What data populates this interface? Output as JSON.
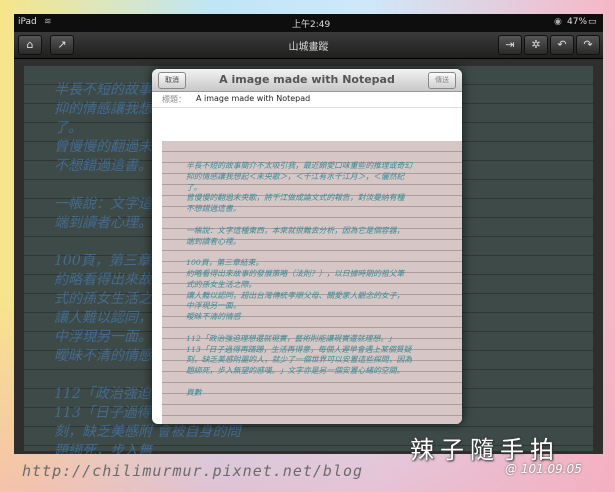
{
  "statusbar": {
    "device": "iPad",
    "time": "上午2:49",
    "battery": "47%"
  },
  "toolbar": {
    "title": "山城畫蹤",
    "home_icon": "home-icon",
    "share_icon": "share-icon",
    "import_icon": "import-icon",
    "settings_icon": "gear-icon",
    "undo_icon": "undo-icon",
    "redo_icon": "redo-icon"
  },
  "background_text": [
    "半長不短的故事：                              的那句「那樣壓",
    "抑的情感讓我想起                              總會讓我放不下",
    "了。",
    "曾慢慢的翻過未                              仍喜愛，所以我",
    "不想錯過這書。",
    "",
    "一帳說：文字這                              腦中盛載內容",
    "端到讀者心理。",
    "",
    "100頁，第三章結",
    "約略看得出來故                              ，穿插在現在",
    "式的孫女生活之",
    "讓人難以認同，                              從藝術的敘說",
    "中浮現另一面。",
    "曖昧不清的情感",
    "",
    "112「政治強迫現",
    "113「日子過得再                              值何在的時",
    "刻，缺乏美感附                              會被自身的問",
    "題綁死，步入無"
  ],
  "dialog": {
    "title": "A image made with Notepad",
    "cancel_label": "取消",
    "send_label": "傳送",
    "subject_label": "標題：",
    "subject_value": "A image made with Notepad"
  },
  "document_lines": [
    "半長不短的故事簡介不太吸引我，最近頗愛口味重些的推理或奇幻",
    "抑的情感讓我想起＜未央歌＞，＜千江有水千江月＞，＜儷然紀",
    "了。",
    "曾慢慢的翻過未央歌，將千江做成論文式的報告，對淡曼納有種",
    "不想錯過這書。",
    "",
    "一帳說：文字這種東西，本來就很難去分析，因為它是個容器，",
    "端到讀者心裡。",
    "",
    "100頁，第三章結束。",
    "約略看得出來故事的發展策略（法則？），以日據時期的祖父筆",
    "式的孫女生活之際。",
    "讓人難以認同，超出台灣傳統孝順父母、關愛家人觀念的女子，",
    "中浮現另一面。",
    "曖昧不清的情感",
    "",
    "112「政治強迫理想還就現實，藝術則能讓現實還就理想。」",
    "113「日子過得再蹣跚，生活再得意，每個人遲早會遇上某個質疑",
    "刻，缺乏美感附麗的人，就少了一個世界可以安置這些探問，因為",
    "題綁死，步入無望的感嘆。」文字亦是另一個安置心緒的空間。",
    "",
    "頁數"
  ],
  "watermark": {
    "url": "http://chilimurmur.pixnet.net/blog",
    "signature": "辣子隨手拍",
    "date": "@ 101.09.05"
  }
}
